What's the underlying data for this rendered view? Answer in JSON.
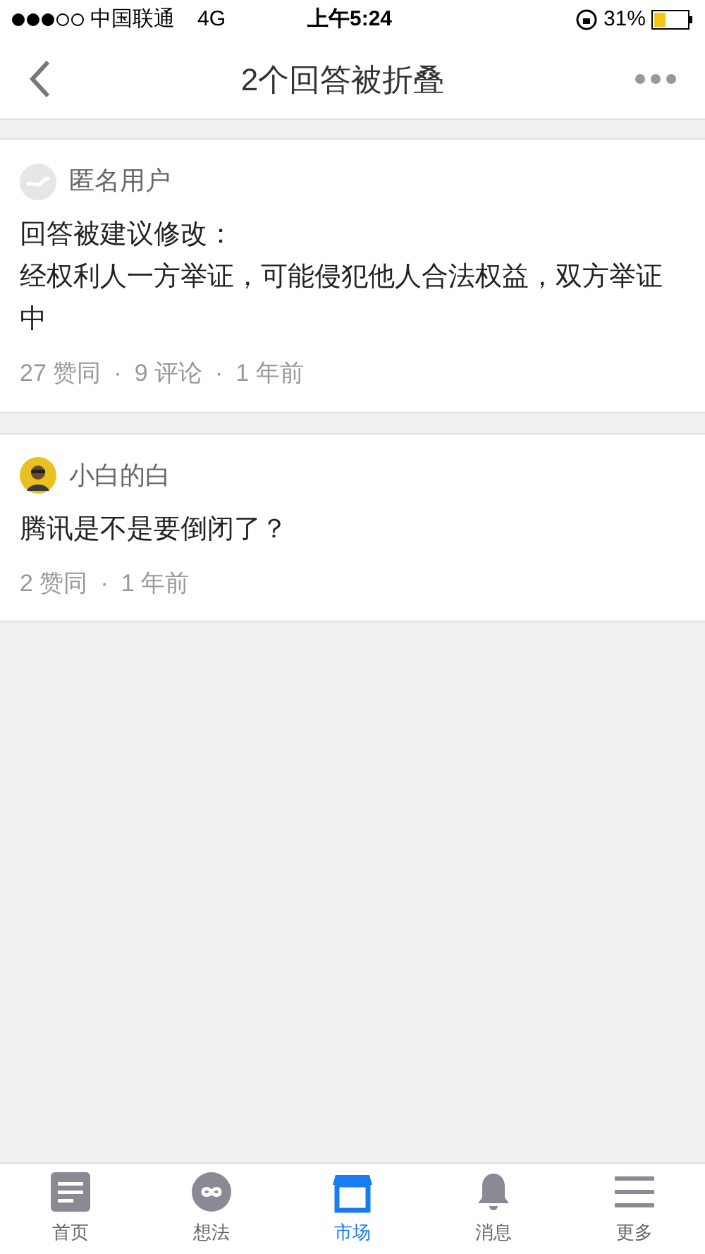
{
  "status_bar": {
    "carrier": "中国联通",
    "network": "4G",
    "time": "上午5:24",
    "battery": "31%"
  },
  "nav": {
    "title": "2个回答被折叠"
  },
  "answers": [
    {
      "author": "匿名用户",
      "avatar": {
        "kind": "anonymous"
      },
      "body": [
        "回答被建议修改：",
        "经权利人一方举证，可能侵犯他人合法权益，双方举证中"
      ],
      "meta": [
        "27 赞同",
        "9 评论",
        "1 年前"
      ]
    },
    {
      "author": "小白的白",
      "avatar": {
        "kind": "user"
      },
      "body": [
        "腾讯是不是要倒闭了？"
      ],
      "meta": [
        "2 赞同",
        "1 年前"
      ]
    }
  ],
  "meta_separator": "·",
  "tab_bar": [
    {
      "label": "首页",
      "kind": "home",
      "selected": false
    },
    {
      "label": "想法",
      "kind": "ideas",
      "selected": false
    },
    {
      "label": "市场",
      "kind": "market",
      "selected": true
    },
    {
      "label": "消息",
      "kind": "bell",
      "selected": false
    },
    {
      "label": "更多",
      "kind": "more",
      "selected": false
    }
  ]
}
